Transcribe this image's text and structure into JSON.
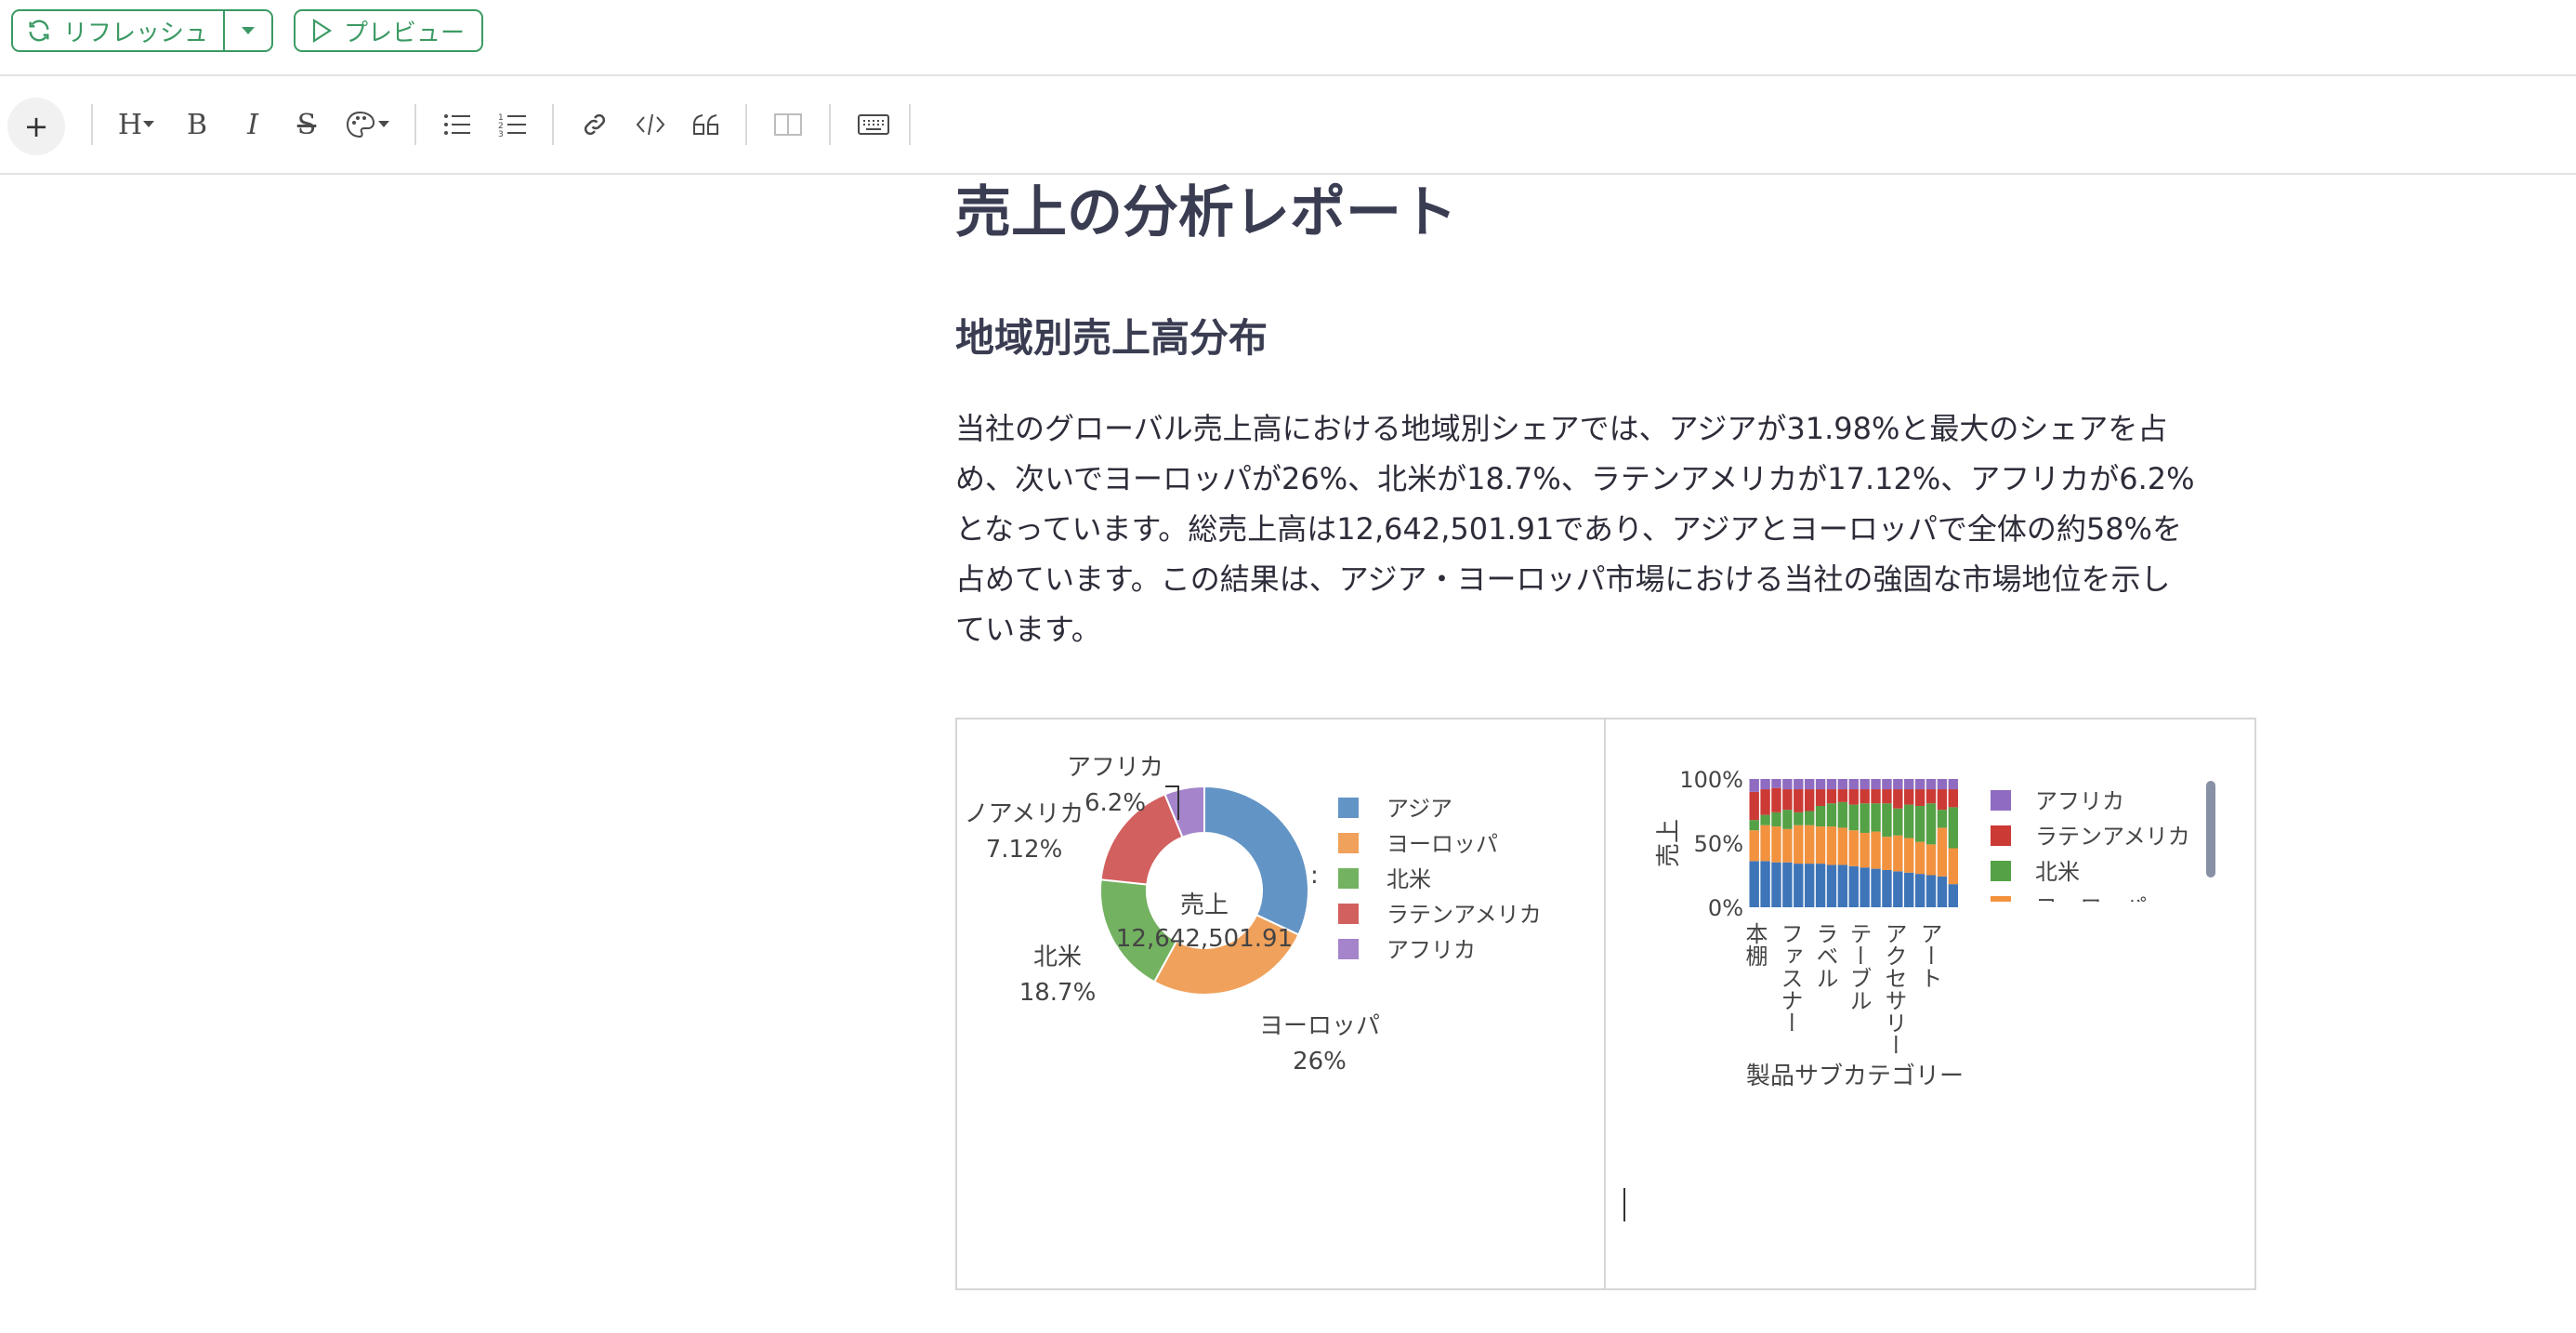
{
  "header": {
    "refresh_label": "リフレッシュ",
    "preview_label": "プレビュー"
  },
  "toolbar": {
    "plus": "+",
    "heading": "H",
    "bold": "B",
    "italic": "I",
    "strike": "S"
  },
  "document": {
    "title": "売上の分析レポート",
    "section_title": "地域別売上高分布",
    "paragraph_lines": [
      "当社のグローバル売上高における地域別シェアでは、アジアが31.98%と最大のシェアを占",
      "め、次いでヨーロッパが26%、北米が18.7%、ラテンアメリカが17.12%、アフリカが6.2%",
      "となっています。総売上高は12,642,501.91であり、アジアとヨーロッパで全体の約58%を",
      "占めています。この結果は、アジア・ヨーロッパ市場における当社の強固な市場地位を示し",
      "ています。"
    ]
  },
  "colors": {
    "accent": "#3b9a63",
    "asia": "#6394c6",
    "europe": "#f0a15b",
    "north_america": "#73b261",
    "latin_america": "#d2605e",
    "africa": "#a584cb"
  },
  "chart_data": [
    {
      "type": "pie",
      "center_label": "売上",
      "center_value": "12,642,501.91",
      "slices": [
        {
          "name": "アジア",
          "value": 31.98,
          "color": "#6394c6"
        },
        {
          "name": "ヨーロッパ",
          "value": 26,
          "color": "#f0a15b",
          "label": "ヨーロッパ",
          "pct": "26%"
        },
        {
          "name": "北米",
          "value": 18.7,
          "color": "#73b261",
          "label": "北米",
          "pct": "18.7%"
        },
        {
          "name": "ラテンアメリカ",
          "value": 17.12,
          "color": "#d2605e",
          "label": "ノアメリカ",
          "pct": "7.12%"
        },
        {
          "name": "アフリカ",
          "value": 6.2,
          "color": "#a584cb",
          "label": "アフリカ",
          "pct": "6.2%"
        }
      ],
      "legend": [
        "アジア",
        "ヨーロッパ",
        "北米",
        "ラテンアメリカ",
        "アフリカ"
      ],
      "legend_position": "right"
    },
    {
      "type": "bar",
      "stacked": "percent",
      "xlabel": "製品サブカテゴリー",
      "ylabel": "売上",
      "yticks": [
        "0%",
        "50%",
        "100%"
      ],
      "ylim": [
        0,
        100
      ],
      "visible_x_tick_labels": [
        "本棚",
        "ファスナー",
        "ラベル",
        "テーブル",
        "アクセサリー",
        "アート"
      ],
      "series": [
        {
          "name": "アジア",
          "color": "#3e75b8",
          "values": [
            36,
            36,
            35,
            35,
            34,
            34,
            34,
            33,
            33,
            32,
            31,
            30,
            29,
            28,
            27,
            26,
            25,
            24,
            18
          ]
        },
        {
          "name": "ヨーロッパ",
          "color": "#f2923f",
          "values": [
            24,
            28,
            28,
            26,
            30,
            30,
            29,
            30,
            29,
            28,
            27,
            29,
            26,
            28,
            27,
            25,
            24,
            38,
            28
          ]
        },
        {
          "name": "北米",
          "color": "#55a146",
          "values": [
            8,
            8,
            11,
            15,
            10,
            11,
            16,
            18,
            20,
            20,
            23,
            22,
            26,
            21,
            26,
            28,
            32,
            14,
            32
          ]
        },
        {
          "name": "ラテンアメリカ",
          "color": "#cc3a36",
          "values": [
            22,
            20,
            19,
            16,
            18,
            17,
            13,
            11,
            10,
            12,
            11,
            11,
            11,
            15,
            12,
            13,
            11,
            16,
            14
          ]
        },
        {
          "name": "アフリカ",
          "color": "#8f6cc1",
          "values": [
            10,
            8,
            7,
            8,
            8,
            8,
            8,
            8,
            8,
            8,
            8,
            8,
            8,
            8,
            8,
            8,
            8,
            8,
            8
          ]
        }
      ],
      "legend": [
        "アフリカ",
        "ラテンアメリカ",
        "北米",
        "ヨーロッパ"
      ],
      "legend_position": "right"
    }
  ]
}
